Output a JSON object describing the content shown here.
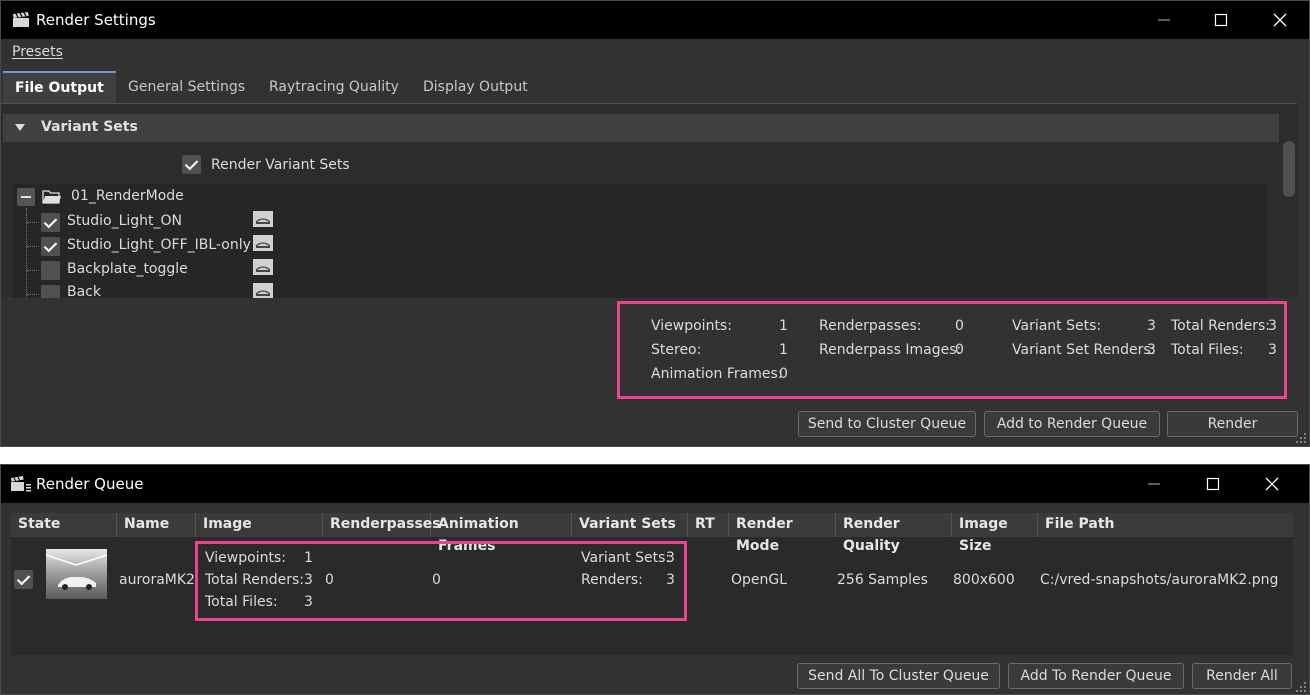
{
  "render_settings": {
    "title": "Render Settings",
    "menu": {
      "presets": "Presets"
    },
    "tabs": [
      {
        "label": "File Output",
        "active": true
      },
      {
        "label": "General Settings",
        "active": false
      },
      {
        "label": "Raytracing Quality",
        "active": false
      },
      {
        "label": "Display Output",
        "active": false
      }
    ],
    "section_title": "Variant Sets",
    "render_variant_sets": {
      "label": "Render Variant Sets",
      "checked": true
    },
    "tree": {
      "group": "01_RenderMode",
      "items": [
        {
          "label": "Studio_Light_ON",
          "checked": true
        },
        {
          "label": "Studio_Light_OFF_IBL-only",
          "checked": true
        },
        {
          "label": "Backplate_toggle",
          "checked": false
        },
        {
          "label": "Back",
          "checked": false
        }
      ]
    },
    "stats": {
      "viewpoints_label": "Viewpoints:",
      "viewpoints": "1",
      "stereo_label": "Stereo:",
      "stereo": "1",
      "animation_frames_label": "Animation Frames:",
      "animation_frames": "0",
      "renderpasses_label": "Renderpasses:",
      "renderpasses": "0",
      "renderpass_images_label": "Renderpass Images:",
      "renderpass_images": "0",
      "variant_sets_label": "Variant Sets:",
      "variant_sets": "3",
      "variant_set_renders_label": "Variant Set Renders:",
      "variant_set_renders": "3",
      "total_renders_label": "Total Renders:",
      "total_renders": "3",
      "total_files_label": "Total Files:",
      "total_files": "3"
    },
    "buttons": {
      "send_to_cluster": "Send to Cluster Queue",
      "add_to_render_queue": "Add to Render Queue",
      "render": "Render"
    }
  },
  "render_queue": {
    "title": "Render Queue",
    "columns": [
      "State",
      "Name",
      "Image",
      "Renderpasses",
      "Animation Frames",
      "Variant Sets",
      "RT",
      "Render Mode",
      "Render Quality",
      "Image Size",
      "File Path"
    ],
    "row": {
      "checked": true,
      "name": "auroraMK2",
      "image": {
        "viewpoints_label": "Viewpoints:",
        "viewpoints": "1",
        "total_renders_label": "Total Renders:",
        "total_renders": "3",
        "total_files_label": "Total Files:",
        "total_files": "3"
      },
      "renderpasses": "0",
      "animation_frames": "0",
      "variant_sets": {
        "variant_sets_label": "Variant Sets:",
        "variant_sets": "3",
        "renders_label": "Renders:",
        "renders": "3"
      },
      "render_mode": "OpenGL",
      "render_quality": "256 Samples",
      "image_size": "800x600",
      "file_path": "C:/vred-snapshots/auroraMK2.png"
    },
    "buttons": {
      "send_all_to_cluster": "Send All To Cluster Queue",
      "add_to_render_queue": "Add To Render Queue",
      "render_all": "Render All"
    }
  },
  "colors": {
    "highlight": "#e8468c",
    "window_bg": "#323232",
    "titlebar_bg": "#000000"
  }
}
